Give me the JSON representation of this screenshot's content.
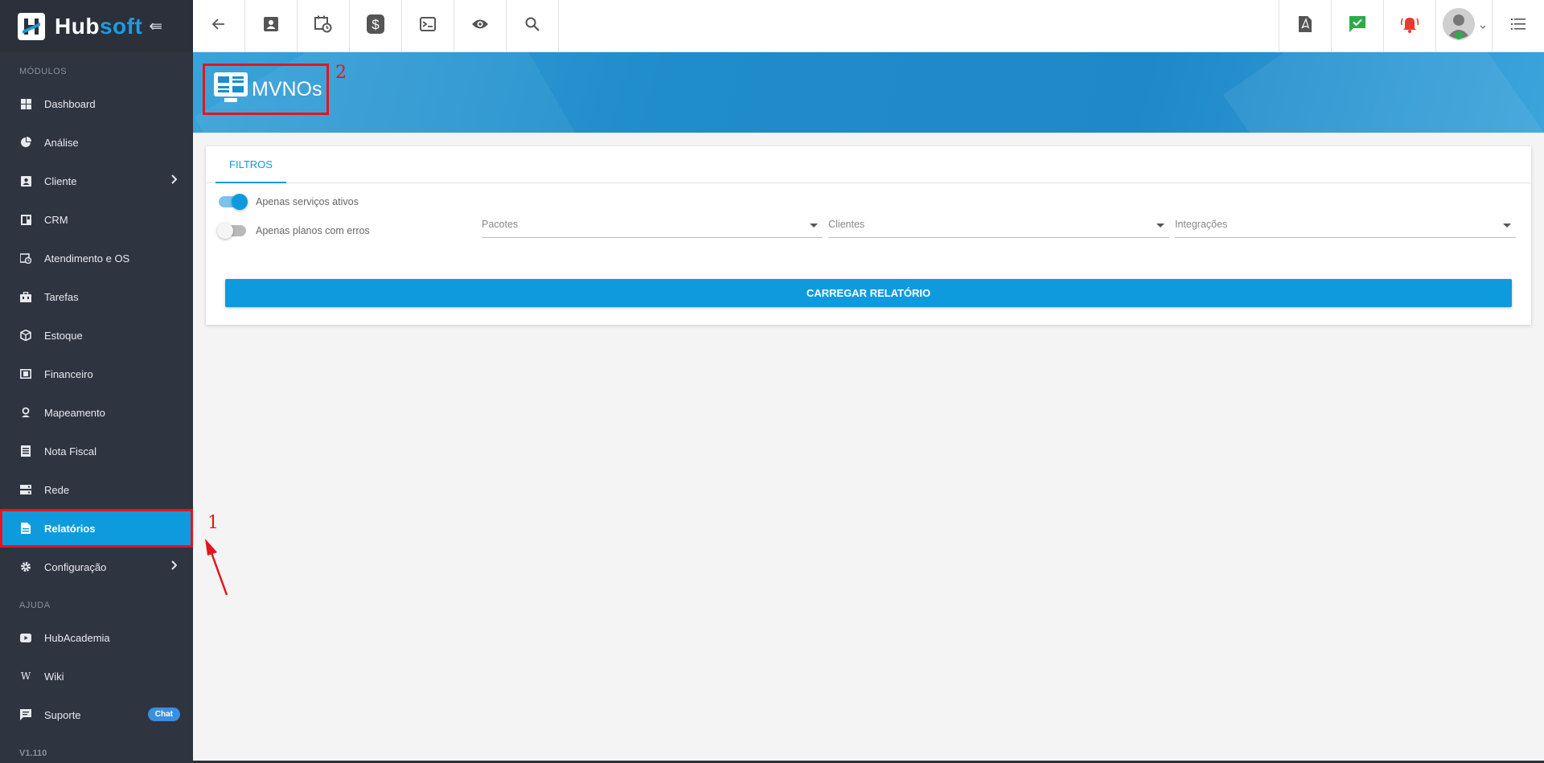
{
  "app": {
    "logo_hub": "Hub",
    "logo_soft": "soft",
    "version": "V1.110"
  },
  "sidebar": {
    "section_modules": "MÓDULOS",
    "section_help": "AJUDA",
    "items": [
      {
        "label": "Dashboard",
        "icon": "grid-icon"
      },
      {
        "label": "Análise",
        "icon": "pie-chart-icon"
      },
      {
        "label": "Cliente",
        "icon": "contact-card-icon"
      },
      {
        "label": "CRM",
        "icon": "crm-icon"
      },
      {
        "label": "Atendimento e OS",
        "icon": "calendar-clock-icon"
      },
      {
        "label": "Tarefas",
        "icon": "briefcase-icon"
      },
      {
        "label": "Estoque",
        "icon": "box-icon"
      },
      {
        "label": "Financeiro",
        "icon": "money-icon"
      },
      {
        "label": "Mapeamento",
        "icon": "map-pin-icon"
      },
      {
        "label": "Nota Fiscal",
        "icon": "invoice-icon"
      },
      {
        "label": "Rede",
        "icon": "server-icon"
      },
      {
        "label": "Relatórios",
        "icon": "report-icon"
      },
      {
        "label": "Configuração",
        "icon": "gear-icon"
      }
    ],
    "help_items": [
      {
        "label": "HubAcademia",
        "icon": "youtube-icon"
      },
      {
        "label": "Wiki",
        "icon": "wikipedia-icon"
      },
      {
        "label": "Suporte",
        "icon": "chat-icon",
        "badge": "Chat"
      }
    ]
  },
  "page": {
    "title": "MVNOs"
  },
  "annotations": {
    "marker_1": "1",
    "marker_2": "2"
  },
  "filters": {
    "tab_label": "FILTROS",
    "toggle_active_services": {
      "label": "Apenas serviços ativos",
      "on": true
    },
    "toggle_plan_errors": {
      "label": "Apenas planos com erros",
      "on": false
    },
    "select_packages": {
      "placeholder": "Pacotes"
    },
    "select_clients": {
      "placeholder": "Clientes"
    },
    "select_integrations": {
      "placeholder": "Integrações"
    },
    "load_button": "CARREGAR RELATÓRIO"
  },
  "colors": {
    "accent": "#0d9bde",
    "sidebar_bg": "#2f3441",
    "annotation": "#e6141c"
  }
}
